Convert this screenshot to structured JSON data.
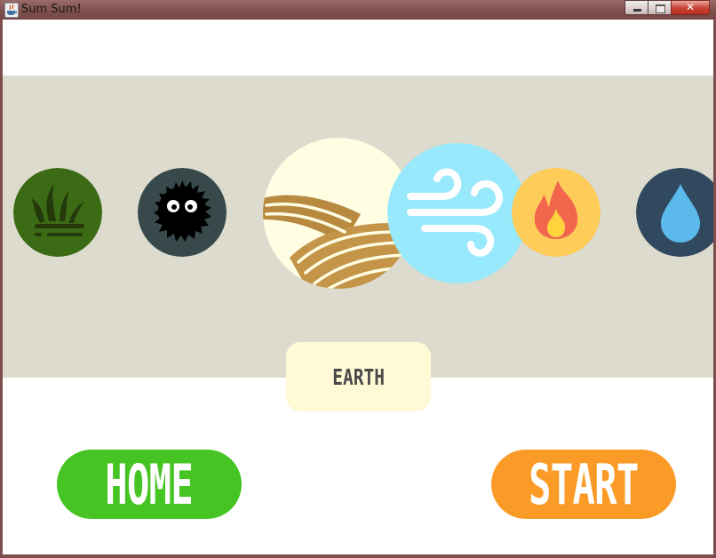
{
  "window": {
    "title": "Sum Sum!",
    "controls": {
      "close_glyph": "✕"
    }
  },
  "carousel": {
    "elements": [
      {
        "name": "grass",
        "icon": "grass-icon",
        "color": "#3b6b14"
      },
      {
        "name": "soot",
        "icon": "soot-sprite-icon",
        "color": "#37494b"
      },
      {
        "name": "earth",
        "icon": "earth-field-icon",
        "color": "#fffde2",
        "selected": true
      },
      {
        "name": "wind",
        "icon": "wind-icon",
        "color": "#97e9fb"
      },
      {
        "name": "fire",
        "icon": "fire-icon",
        "color": "#fecc58"
      },
      {
        "name": "water",
        "icon": "water-drop-icon",
        "color": "#30495f"
      }
    ],
    "band_color": "#dcdbce"
  },
  "selected_label": "EARTH",
  "buttons": {
    "home": {
      "label": "HOME",
      "color": "#45c423"
    },
    "start": {
      "label": "START",
      "color": "#fb9b27"
    }
  }
}
